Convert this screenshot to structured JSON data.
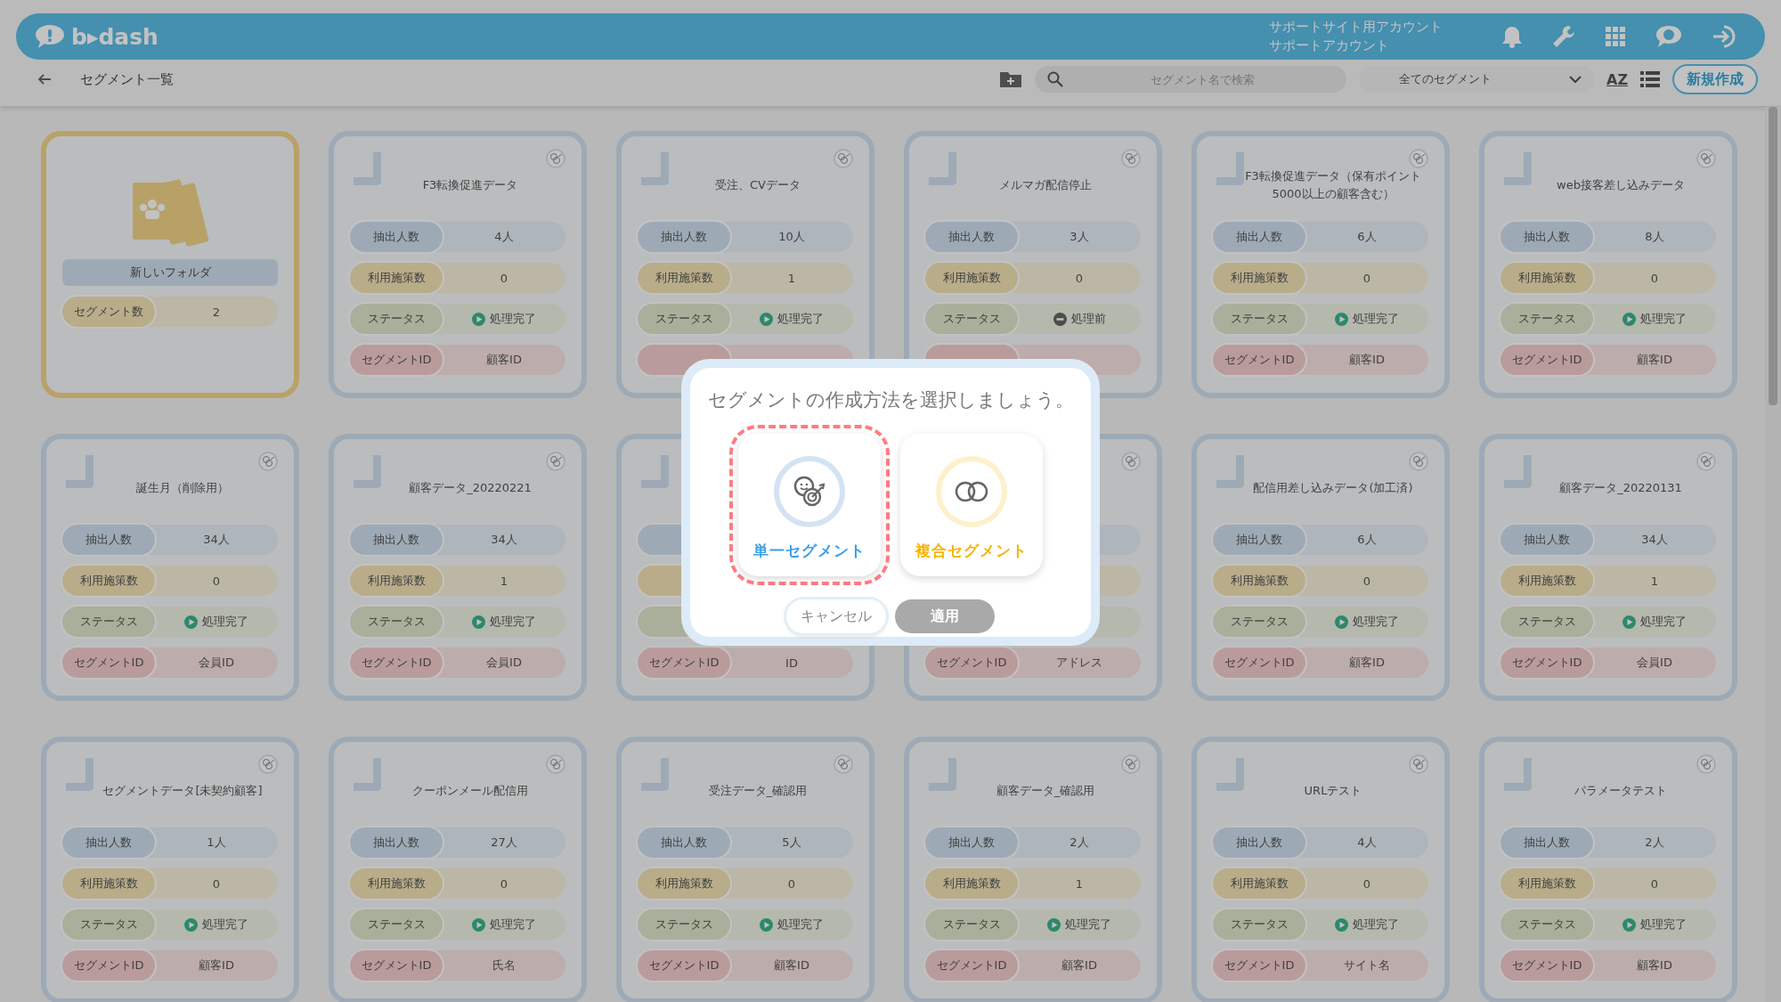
{
  "header": {
    "logo": "b▸dash",
    "account_lines": [
      "サポートサイト用アカウント",
      "サポートアカウント"
    ]
  },
  "toolbar": {
    "title": "セグメント一覧",
    "search": {
      "placeholder": "セグメント名で検索"
    },
    "filter": {
      "value": "全てのセグメント"
    },
    "sort_label": "AZ",
    "new_button": "新規作成"
  },
  "folder": {
    "name": "新しいフォルダ",
    "row": {
      "label": "セグメント数",
      "value": "2"
    }
  },
  "cards": [
    {
      "title": "F3転換促進データ",
      "rows": [
        {
          "kind": "count",
          "label": "抽出人数",
          "value": "4人"
        },
        {
          "kind": "measures",
          "label": "利用施策数",
          "value": "0"
        },
        {
          "kind": "status",
          "label": "ステータス",
          "value": "処理完了",
          "complete": true
        },
        {
          "kind": "segment_id",
          "label": "セグメントID",
          "value": "顧客ID"
        }
      ]
    },
    {
      "title": "受注、CVデータ",
      "rows": [
        {
          "kind": "count",
          "label": "抽出人数",
          "value": "10人"
        },
        {
          "kind": "measures",
          "label": "利用施策数",
          "value": "1"
        },
        {
          "kind": "status",
          "label": "ステータス",
          "value": "処理完了",
          "complete": true
        },
        {
          "kind": "segment_id"
        }
      ]
    },
    {
      "title": "メルマガ配信停止",
      "rows": [
        {
          "kind": "count",
          "label": "抽出人数",
          "value": "3人"
        },
        {
          "kind": "measures",
          "label": "利用施策数",
          "value": "0"
        },
        {
          "kind": "status",
          "label": "ステータス",
          "value": "処理前",
          "complete": false
        },
        {
          "kind": "segment_id"
        }
      ]
    },
    {
      "title": "F3転換促進データ（保有ポイント5000以上の顧客含む）",
      "rows": [
        {
          "kind": "count",
          "label": "抽出人数",
          "value": "6人"
        },
        {
          "kind": "measures",
          "label": "利用施策数",
          "value": "0"
        },
        {
          "kind": "status",
          "label": "ステータス",
          "value": "処理完了",
          "complete": true
        },
        {
          "kind": "segment_id",
          "label": "セグメントID",
          "value": "顧客ID"
        }
      ]
    },
    {
      "title": "web接客差し込みデータ",
      "rows": [
        {
          "kind": "count",
          "label": "抽出人数",
          "value": "8人"
        },
        {
          "kind": "measures",
          "label": "利用施策数",
          "value": "0"
        },
        {
          "kind": "status",
          "label": "ステータス",
          "value": "処理完了",
          "complete": true
        },
        {
          "kind": "segment_id",
          "label": "セグメントID",
          "value": "顧客ID"
        }
      ]
    },
    {
      "title": "誕生月（削除用）",
      "rows": [
        {
          "kind": "count",
          "label": "抽出人数",
          "value": "34人"
        },
        {
          "kind": "measures",
          "label": "利用施策数",
          "value": "0"
        },
        {
          "kind": "status",
          "label": "ステータス",
          "value": "処理完了",
          "complete": true
        },
        {
          "kind": "segment_id",
          "label": "セグメントID",
          "value": "会員ID"
        }
      ]
    },
    {
      "title": "顧客データ_20220221",
      "rows": [
        {
          "kind": "count",
          "label": "抽出人数",
          "value": "34人"
        },
        {
          "kind": "measures",
          "label": "利用施策数",
          "value": "1"
        },
        {
          "kind": "status",
          "label": "ステータス",
          "value": "処理完了",
          "complete": true
        },
        {
          "kind": "segment_id",
          "label": "セグメントID",
          "value": "会員ID"
        }
      ]
    },
    {
      "rows": [
        {
          "kind": "count"
        },
        {
          "kind": "measures"
        },
        {
          "kind": "status"
        },
        {
          "kind": "segment_id",
          "label": "セグメントID",
          "value": "ID"
        }
      ]
    },
    {
      "rows": [
        {
          "kind": "count"
        },
        {
          "kind": "measures"
        },
        {
          "kind": "status"
        },
        {
          "kind": "segment_id",
          "label": "セグメントID",
          "value": "アドレス"
        }
      ]
    },
    {
      "title": "配信用差し込みデータ(加工済)",
      "rows": [
        {
          "kind": "count",
          "label": "抽出人数",
          "value": "6人"
        },
        {
          "kind": "measures",
          "label": "利用施策数",
          "value": "0"
        },
        {
          "kind": "status",
          "label": "ステータス",
          "value": "処理完了",
          "complete": true
        },
        {
          "kind": "segment_id",
          "label": "セグメントID",
          "value": "顧客ID"
        }
      ]
    },
    {
      "title": "顧客データ_20220131",
      "rows": [
        {
          "kind": "count",
          "label": "抽出人数",
          "value": "34人"
        },
        {
          "kind": "measures",
          "label": "利用施策数",
          "value": "1"
        },
        {
          "kind": "status",
          "label": "ステータス",
          "value": "処理完了",
          "complete": true
        },
        {
          "kind": "segment_id",
          "label": "セグメントID",
          "value": "会員ID"
        }
      ]
    },
    {
      "title": "セグメントデータ[未契約顧客]",
      "rows": [
        {
          "kind": "count",
          "label": "抽出人数",
          "value": "1人"
        },
        {
          "kind": "measures",
          "label": "利用施策数",
          "value": "0"
        },
        {
          "kind": "status",
          "label": "ステータス",
          "value": "処理完了",
          "complete": true
        },
        {
          "kind": "segment_id",
          "label": "セグメントID",
          "value": "顧客ID"
        }
      ]
    },
    {
      "title": "クーポンメール配信用",
      "rows": [
        {
          "kind": "count",
          "label": "抽出人数",
          "value": "27人"
        },
        {
          "kind": "measures",
          "label": "利用施策数",
          "value": "0"
        },
        {
          "kind": "status",
          "label": "ステータス",
          "value": "処理完了",
          "complete": true
        },
        {
          "kind": "segment_id",
          "label": "セグメントID",
          "value": "氏名"
        }
      ]
    },
    {
      "title": "受注データ_確認用",
      "rows": [
        {
          "kind": "count",
          "label": "抽出人数",
          "value": "5人"
        },
        {
          "kind": "measures",
          "label": "利用施策数",
          "value": "0"
        },
        {
          "kind": "status",
          "label": "ステータス",
          "value": "処理完了",
          "complete": true
        },
        {
          "kind": "segment_id",
          "label": "セグメントID",
          "value": "顧客ID"
        }
      ]
    },
    {
      "title": "顧客データ_確認用",
      "rows": [
        {
          "kind": "count",
          "label": "抽出人数",
          "value": "2人"
        },
        {
          "kind": "measures",
          "label": "利用施策数",
          "value": "1"
        },
        {
          "kind": "status",
          "label": "ステータス",
          "value": "処理完了",
          "complete": true
        },
        {
          "kind": "segment_id",
          "label": "セグメントID",
          "value": "顧客ID"
        }
      ]
    },
    {
      "title": "URLテスト",
      "rows": [
        {
          "kind": "count",
          "label": "抽出人数",
          "value": "4人"
        },
        {
          "kind": "measures",
          "label": "利用施策数",
          "value": "0"
        },
        {
          "kind": "status",
          "label": "ステータス",
          "value": "処理完了",
          "complete": true
        },
        {
          "kind": "segment_id",
          "label": "セグメントID",
          "value": "サイト名"
        }
      ]
    },
    {
      "title": "パラメータテスト",
      "rows": [
        {
          "kind": "count",
          "label": "抽出人数",
          "value": "2人"
        },
        {
          "kind": "measures",
          "label": "利用施策数",
          "value": "0"
        },
        {
          "kind": "status",
          "label": "ステータス",
          "value": "処理完了",
          "complete": true
        },
        {
          "kind": "segment_id",
          "label": "セグメントID",
          "value": "顧客ID"
        }
      ]
    }
  ],
  "dialog": {
    "title": "セグメントの作成方法を選択しましょう。",
    "options": [
      {
        "kind": "single",
        "label": "単一セグメント",
        "selected": true
      },
      {
        "kind": "combined",
        "label": "複合セグメント",
        "selected": false
      }
    ],
    "buttons": [
      {
        "label": "キャンセル",
        "disabled": false
      },
      {
        "label": "適用",
        "disabled": true
      }
    ]
  }
}
